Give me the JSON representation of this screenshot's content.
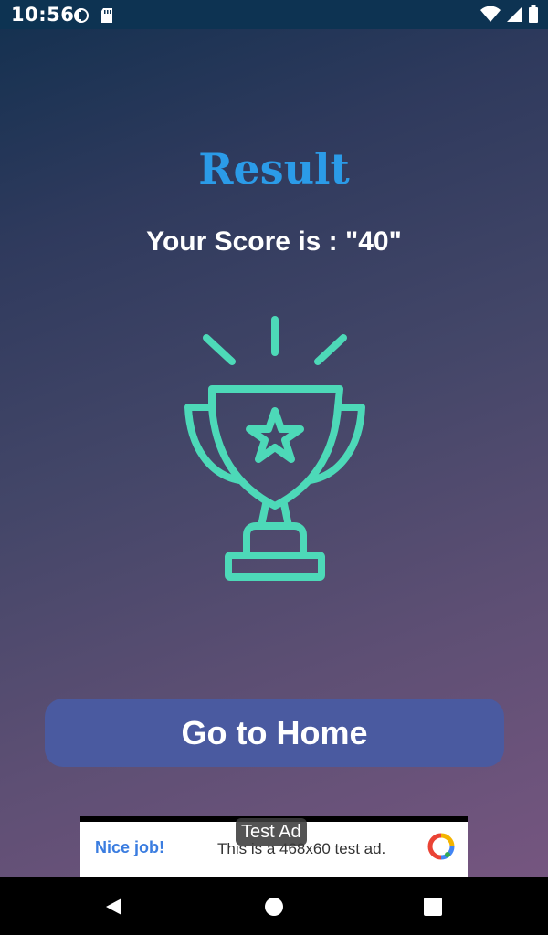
{
  "status_bar": {
    "time": "10:56",
    "icons_left": [
      "app-notification-icon",
      "sd-card-icon"
    ],
    "icons_right": [
      "wifi-icon",
      "signal-icon",
      "battery-icon"
    ]
  },
  "result": {
    "title": "Result",
    "score_text": "Your Score is : \"40\"",
    "trophy_icon": "trophy-icon"
  },
  "home_button": {
    "label": "Go to Home"
  },
  "ad": {
    "label": "Test Ad",
    "cta": "Nice job!",
    "text": "This is a 468x60 test ad.",
    "logo_icon": "ad-network-logo-icon"
  },
  "nav_bar": {
    "buttons": [
      "back-icon",
      "home-icon",
      "recents-icon"
    ]
  },
  "colors": {
    "title": "#2b9be8",
    "trophy": "#4dd9b8",
    "button": "#4a5aa0",
    "status_bar": "#0d3352"
  }
}
